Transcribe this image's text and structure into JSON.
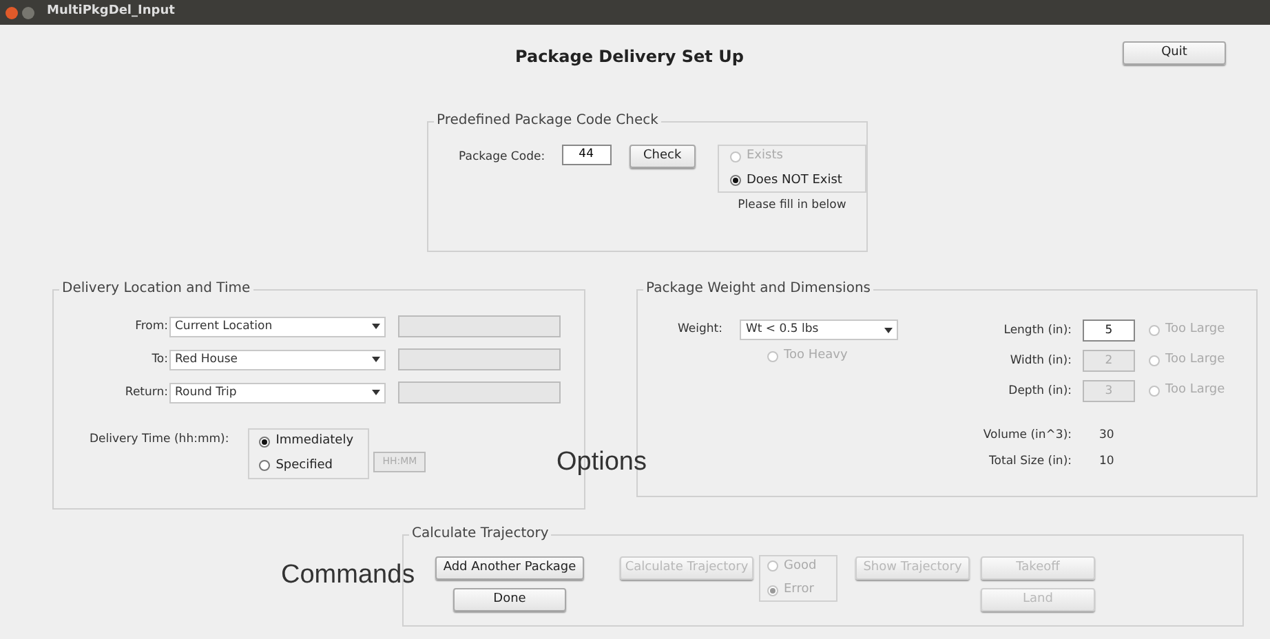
{
  "window": {
    "title": "MultiPkgDel_Input"
  },
  "heading": "Package Delivery Set Up",
  "quit_button": "Quit",
  "code_check": {
    "title": "Predefined Package Code Check",
    "label": "Package Code:",
    "value": "44",
    "button": "Check",
    "options": [
      {
        "label": "Exists",
        "selected": false,
        "disabled": true
      },
      {
        "label": "Does NOT Exist",
        "selected": true,
        "disabled": false
      }
    ],
    "note": "Please fill in below"
  },
  "delivery": {
    "title": "Delivery Location and Time",
    "rows": [
      {
        "label": "From:",
        "value": "Current Location"
      },
      {
        "label": "To:",
        "value": "Red House"
      },
      {
        "label": "Return:",
        "value": "Round Trip"
      }
    ],
    "time_label": "Delivery Time (hh:mm):",
    "time_options": [
      {
        "label": "Immediately",
        "selected": true
      },
      {
        "label": "Specified",
        "selected": false
      }
    ],
    "time_placeholder": "HH:MM"
  },
  "package": {
    "title": "Package Weight and Dimensions",
    "weight_label": "Weight:",
    "weight_value": "Wt < 0.5 lbs",
    "too_heavy": {
      "label": "Too Heavy",
      "checked": false
    },
    "dims": [
      {
        "label": "Length (in):",
        "value": "5",
        "disabled": false,
        "warning": "Too Large",
        "checked": false
      },
      {
        "label": "Width (in):",
        "value": "2",
        "disabled": true,
        "warning": "Too Large",
        "checked": false
      },
      {
        "label": "Depth (in):",
        "value": "3",
        "disabled": true,
        "warning": "Too Large",
        "checked": false
      }
    ],
    "results": [
      {
        "label": "Volume (in^3):",
        "value": "30"
      },
      {
        "label": "Total Size (in):",
        "value": "10"
      }
    ]
  },
  "annotations": [
    "Options",
    "Commands"
  ],
  "trajectory": {
    "title": "Calculate Trajectory",
    "add_button": {
      "label": "Add Another Package",
      "disabled": false
    },
    "done_button": {
      "label": "Done",
      "disabled": false
    },
    "calc_button": {
      "label": "Calculate Trajectory",
      "disabled": true
    },
    "status": [
      {
        "label": "Good",
        "selected": false
      },
      {
        "label": "Error",
        "selected": true
      }
    ],
    "show_button": {
      "label": "Show Trajectory",
      "disabled": true
    },
    "takeoff_button": {
      "label": "Takeoff",
      "disabled": true
    },
    "land_button": {
      "label": "Land",
      "disabled": true
    }
  }
}
